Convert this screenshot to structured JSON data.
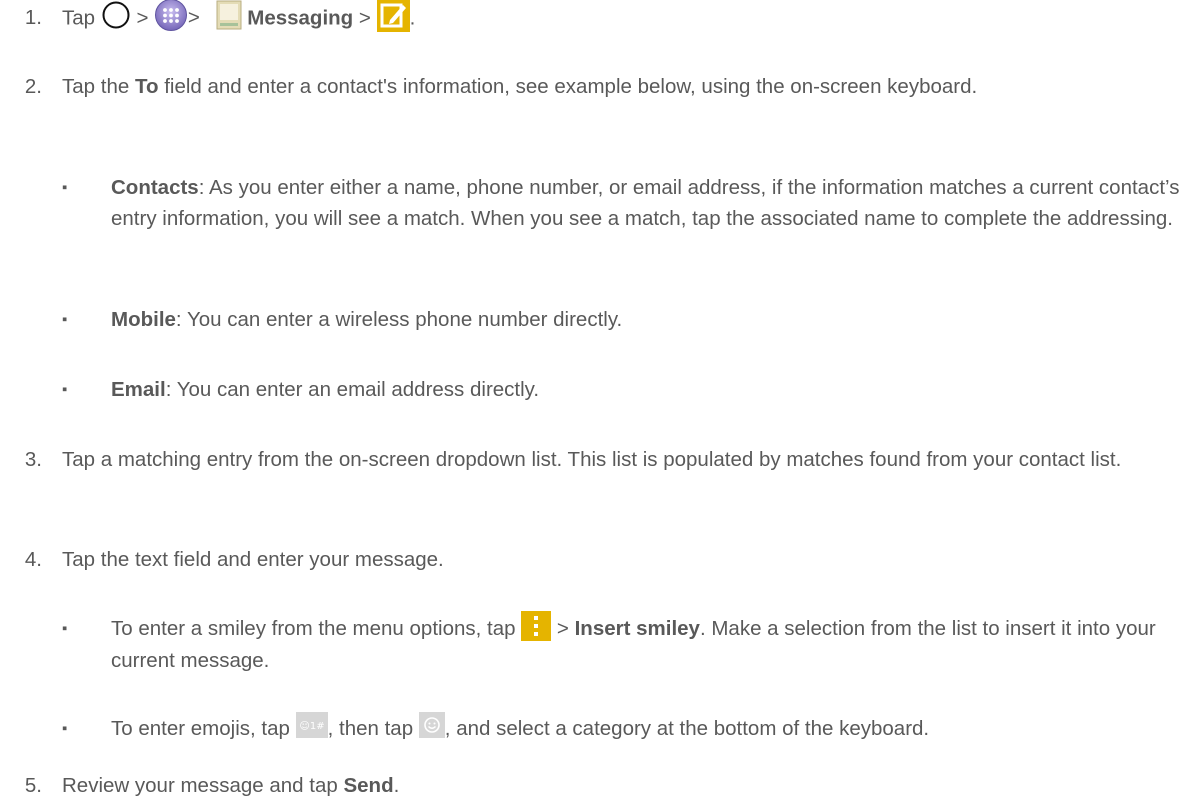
{
  "steps": [
    {
      "number": "1.",
      "tap": "Tap",
      "sep1": ">",
      "sep2": ">",
      "messaging": "Messaging",
      "sep3": ">",
      "end": "."
    },
    {
      "number": "2.",
      "pre": "Tap the",
      "bold": "To",
      "post": "field and enter a contact's information, see example below, using the on-screen keyboard."
    },
    {
      "number": "3.",
      "text": "Tap a matching entry from the on-screen dropdown list. This list is populated by matches found from your contact list."
    },
    {
      "number": "4.",
      "text": "Tap the text field and enter your message."
    },
    {
      "number": "5.",
      "pre": "Review your message and tap",
      "bold": "Send",
      "end": "."
    }
  ],
  "sub_items": {
    "bullet": "▪",
    "contacts": {
      "bold": "Contacts",
      "text": ": As you enter either a name, phone number, or email address, if the information matches a current contact’s entry information, you will see a match. When you see a match, tap the associated name to complete the addressing."
    },
    "mobile": {
      "bold": "Mobile",
      "text": ": You can enter a wireless phone number directly."
    },
    "email": {
      "bold": "Email",
      "text": ": You can enter an email address directly."
    },
    "smiley": {
      "pre": "To enter a smiley from the menu options, tap",
      "sep": ">",
      "bold": "Insert smiley",
      "post": ". Make a selection from the list to insert it into your current message."
    },
    "emoji": {
      "pre": "To enter emojis, tap",
      "key_label": "☺1#",
      "mid": ", then tap",
      "post": ", and select a category at the bottom of the keyboard."
    }
  },
  "colors": {
    "text": "#595959",
    "accent_yellow": "#e5b400",
    "app_icon_beige": "#d8cfa2"
  },
  "icons": [
    "home-button-icon",
    "apps-icon",
    "messaging-app-icon",
    "compose-icon",
    "menu-icon",
    "symbol-key-icon",
    "emoji-icon"
  ]
}
